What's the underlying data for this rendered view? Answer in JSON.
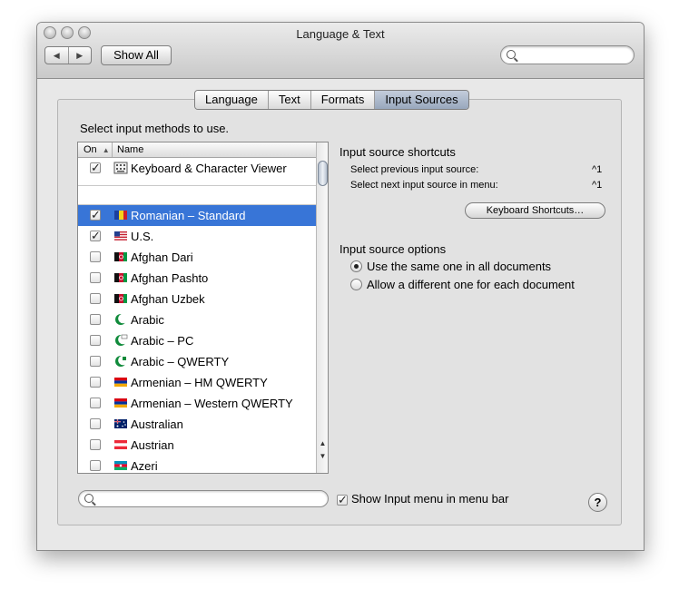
{
  "window": {
    "title": "Language & Text"
  },
  "toolbar": {
    "back_glyph": "◀",
    "forward_glyph": "▶",
    "show_all_label": "Show All",
    "search_placeholder": ""
  },
  "tabs": [
    {
      "label": "Language",
      "selected": false
    },
    {
      "label": "Text",
      "selected": false
    },
    {
      "label": "Formats",
      "selected": false
    },
    {
      "label": "Input Sources",
      "selected": true
    }
  ],
  "input_methods": {
    "instruction": "Select input methods to use.",
    "columns": {
      "on": "On",
      "name": "Name"
    },
    "sort_indicator": "▲",
    "pinned": {
      "label": "Keyboard & Character Viewer",
      "checked": true,
      "icon": "keyboard-viewer-icon"
    },
    "items": [
      {
        "label": "Romanian – Standard",
        "checked": true,
        "selected": true,
        "icon": "flag-romania"
      },
      {
        "label": "U.S.",
        "checked": true,
        "selected": false,
        "icon": "flag-us"
      },
      {
        "label": "Afghan Dari",
        "checked": false,
        "selected": false,
        "icon": "flag-afghanistan"
      },
      {
        "label": "Afghan Pashto",
        "checked": false,
        "selected": false,
        "icon": "flag-afghanistan"
      },
      {
        "label": "Afghan Uzbek",
        "checked": false,
        "selected": false,
        "icon": "flag-afghanistan"
      },
      {
        "label": "Arabic",
        "checked": false,
        "selected": false,
        "icon": "crescent-icon"
      },
      {
        "label": "Arabic – PC",
        "checked": false,
        "selected": false,
        "icon": "crescent-icon"
      },
      {
        "label": "Arabic – QWERTY",
        "checked": false,
        "selected": false,
        "icon": "crescent-icon"
      },
      {
        "label": "Armenian – HM QWERTY",
        "checked": false,
        "selected": false,
        "icon": "flag-armenia"
      },
      {
        "label": "Armenian – Western QWERTY",
        "checked": false,
        "selected": false,
        "icon": "flag-armenia"
      },
      {
        "label": "Australian",
        "checked": false,
        "selected": false,
        "icon": "flag-australia"
      },
      {
        "label": "Austrian",
        "checked": false,
        "selected": false,
        "icon": "flag-austria"
      },
      {
        "label": "Azeri",
        "checked": false,
        "selected": false,
        "icon": "flag-azerbaijan"
      }
    ],
    "search_placeholder": ""
  },
  "shortcuts": {
    "title": "Input source shortcuts",
    "previous_label": "Select previous input source:",
    "previous_key": "^1",
    "next_label": "Select next input source in menu:",
    "next_key": "^1",
    "button_label": "Keyboard Shortcuts…"
  },
  "options": {
    "title": "Input source options",
    "same_label": "Use the same one in all documents",
    "same_selected": true,
    "different_label": "Allow a different one for each document",
    "different_selected": false
  },
  "bottom": {
    "show_menu_label": "Show Input menu in menu bar",
    "show_menu_checked": true,
    "help_glyph": "?"
  },
  "colors": {
    "selection": "#3875d7",
    "tab_selected": "#a8b5c9"
  }
}
